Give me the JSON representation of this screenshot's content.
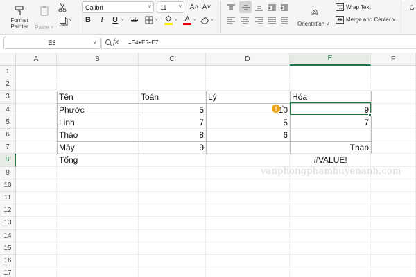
{
  "ribbon": {
    "format_painter_label_1": "Format",
    "format_painter_label_2": "Painter",
    "paste_label": "Paste",
    "font_name": "Calibri",
    "font_size": "11",
    "font_grow": "A˄",
    "font_shrink": "A˅",
    "bold": "B",
    "italic": "I",
    "underline": "U",
    "strikethrough": "ab",
    "font_color_letter": "A",
    "orientation_label": "Orientation",
    "wrap_text_label": "Wrap Text",
    "merge_center_label": "Merge and Center",
    "partial_label": "G",
    "colors": {
      "fill_yellow": "#f7e400",
      "font_red": "#e00000",
      "accent_green": "#217346"
    }
  },
  "formula_bar": {
    "name_box": "E8",
    "fx_label": "fx",
    "formula": "=E4+E5+E7"
  },
  "grid": {
    "columns": [
      "A",
      "B",
      "C",
      "D",
      "E",
      "F"
    ],
    "selected_column": "E",
    "rows": [
      "1",
      "2",
      "3",
      "4",
      "5",
      "6",
      "7",
      "8",
      "9",
      "10",
      "11",
      "12",
      "13",
      "14",
      "15",
      "16",
      "17"
    ],
    "selected_row": "8",
    "cells": {
      "B3": "Tên",
      "C3": "Toán",
      "D3": "Lý",
      "E3": "Hóa",
      "B4": "Phước",
      "C4": "5",
      "D4": "10",
      "E4": "9",
      "B5": "Linh",
      "C5": "7",
      "D5": "5",
      "E5": "7",
      "B6": "Thảo",
      "C6": "8",
      "D6": "6",
      "B7": "Mây",
      "C7": "9",
      "E7": "Thao",
      "B8": "Tổng",
      "E8": "#VALUE!"
    }
  },
  "watermark": "vanphongphamhuyenanh.com"
}
